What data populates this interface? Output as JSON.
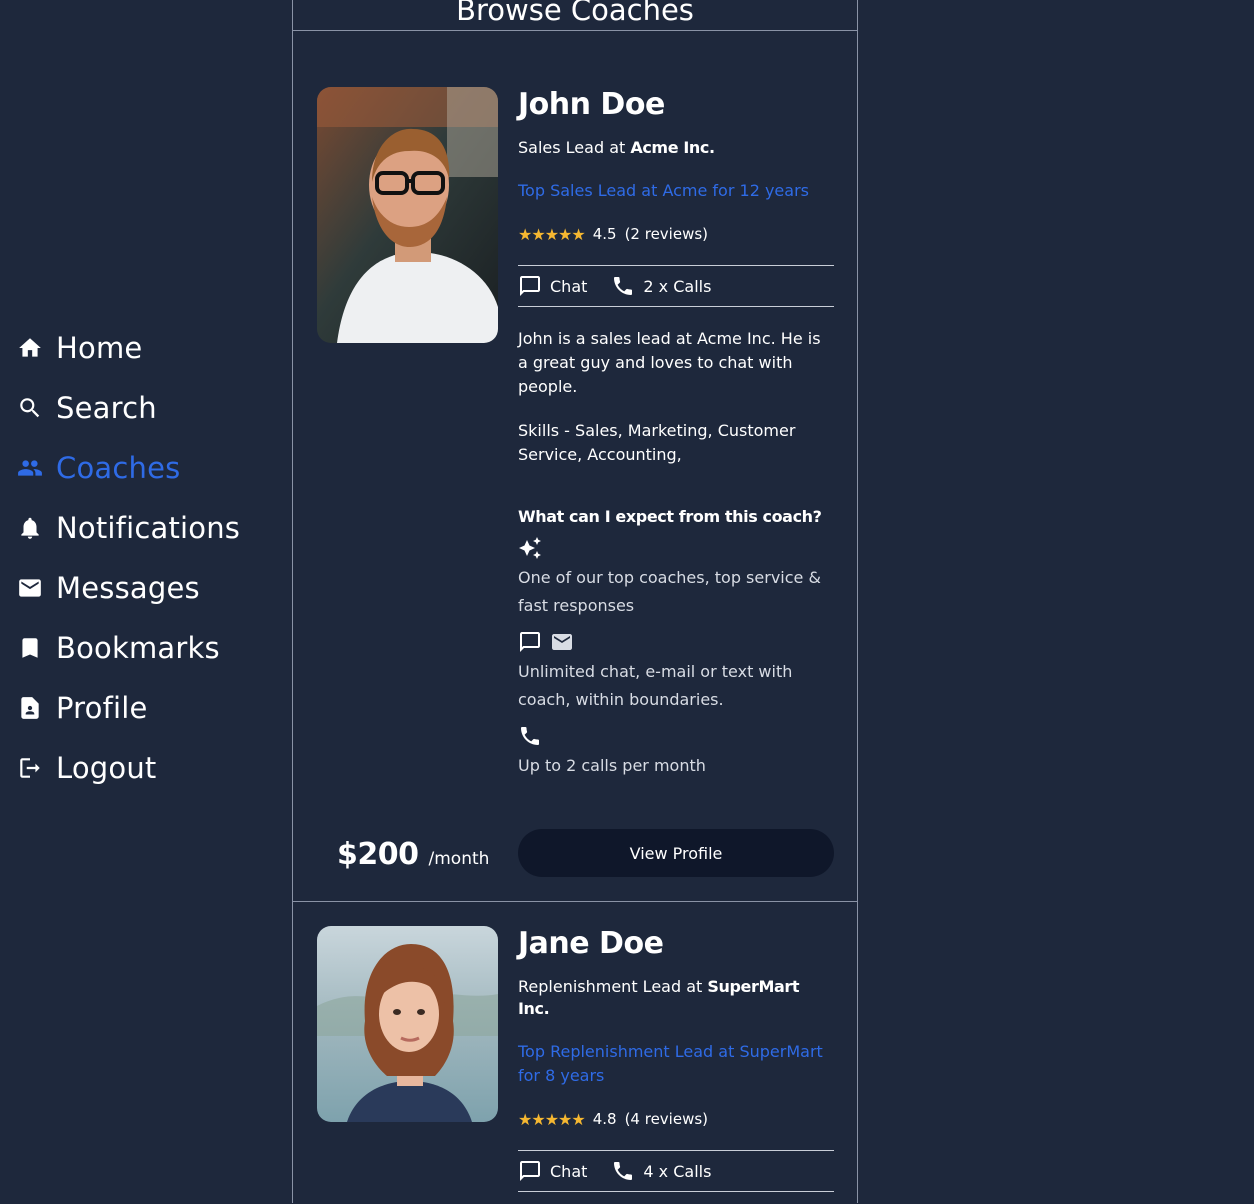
{
  "nav": [
    {
      "label": "Home",
      "icon": "home-icon"
    },
    {
      "label": "Search",
      "icon": "search-icon"
    },
    {
      "label": "Coaches",
      "icon": "people-icon",
      "active": true
    },
    {
      "label": "Notifications",
      "icon": "bell-icon"
    },
    {
      "label": "Messages",
      "icon": "mail-icon"
    },
    {
      "label": "Bookmarks",
      "icon": "bookmark-icon"
    },
    {
      "label": "Profile",
      "icon": "profile-icon"
    },
    {
      "label": "Logout",
      "icon": "logout-icon"
    }
  ],
  "header": {
    "title": "Browse Coaches"
  },
  "coaches": [
    {
      "name": "John Doe",
      "role_prefix": "Sales Lead at ",
      "company": "Acme Inc.",
      "tagline": "Top Sales Lead at Acme for 12 years",
      "stars": "★★★★★",
      "rating": "4.5",
      "reviews": "(2 reviews)",
      "chat_label": "Chat",
      "calls_label": "2 x Calls",
      "bio": "John is a sales lead at Acme Inc. He is a great guy and loves to chat with people.",
      "skills": "Skills - Sales,   Marketing,   Customer Service,   Accounting,",
      "expect_title": "What can I expect from this coach?",
      "expect_items": [
        "One of our top coaches, top service & fast responses",
        "Unlimited chat, e-mail or text with coach, within boundaries.",
        "Up to 2 calls per month"
      ],
      "price": "$200",
      "price_unit": "/month",
      "view_button": "View Profile"
    },
    {
      "name": "Jane Doe",
      "role_prefix": "Replenishment Lead at ",
      "company": "SuperMart Inc.",
      "tagline": "Top Replenishment Lead at SuperMart for 8 years",
      "stars": "★★★★★",
      "rating": "4.8",
      "reviews": "(4 reviews)",
      "chat_label": "Chat",
      "calls_label": "4 x Calls"
    }
  ],
  "colors": {
    "background": "#1e283c",
    "accent": "#2f6be6",
    "star": "#f5b731",
    "button": "#0f172a"
  }
}
